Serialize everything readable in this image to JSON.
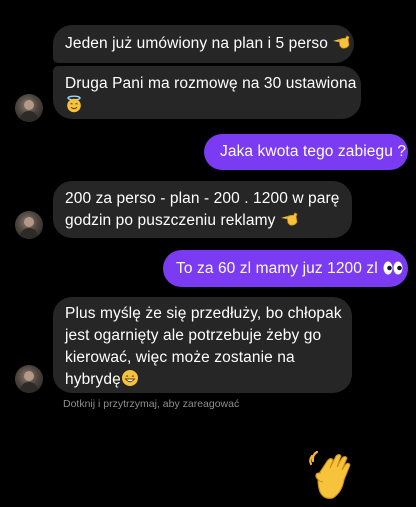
{
  "messages": [
    {
      "id": "m1",
      "direction": "incoming",
      "text": "Jeden już umówiony na plan i 5 perso",
      "emoji": "pointing-hand"
    },
    {
      "id": "m2",
      "direction": "incoming",
      "line1": "Druga Pani ma rozmowę na 30 ustawiona",
      "emoji": "halo-smiley"
    },
    {
      "id": "m3",
      "direction": "outgoing",
      "text": "Jaka kwota tego zabiegu ?"
    },
    {
      "id": "m4",
      "direction": "incoming",
      "line1": "200 za perso - plan - 200 . 1200 w parę",
      "line2": "godzin po puszczeniu reklamy",
      "emoji": "pointing-hand"
    },
    {
      "id": "m5",
      "direction": "outgoing",
      "text": "To za 60 zl mamy juz 1200 zl",
      "emoji": "eyes"
    },
    {
      "id": "m6",
      "direction": "incoming",
      "line1": "Plus myślę że się przedłuży, bo chłopak",
      "line2": "jest ogarnięty ale potrzebuje żeby go",
      "line3": "kierować, więc może zostanie na",
      "line4": "hybrydę",
      "emoji": "grin-smiley"
    }
  ],
  "hint": "Dotknij i przytrzymaj, aby zareagować",
  "reaction": {
    "emoji": "waving-hand"
  },
  "colors": {
    "background": "#000000",
    "incoming_bubble": "#262626",
    "outgoing_bubble": "#7b3bf2",
    "hint_text": "#8e8e8e"
  }
}
